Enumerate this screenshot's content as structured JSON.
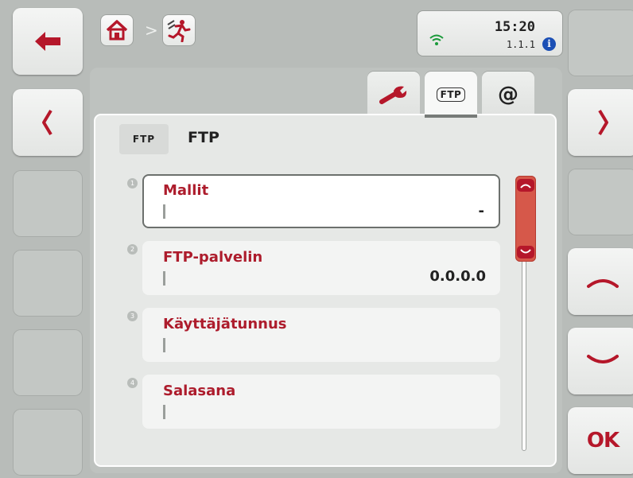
{
  "topbar": {
    "home_icon": "home-icon",
    "separator": ">",
    "app_icon": "ftp-settings-running-man-icon",
    "status": {
      "time": "15:20",
      "version": "1.1.1"
    }
  },
  "left_buttons": {
    "back": "arrow-left-icon",
    "prev": "chevron-left-icon"
  },
  "right_buttons": {
    "next": "chevron-right-icon",
    "up": "chevron-up-icon",
    "down": "chevron-down-icon",
    "ok_label": "OK"
  },
  "tabs": [
    {
      "name": "settings",
      "icon": "wrench-icon"
    },
    {
      "name": "ftp",
      "label": "FTP",
      "active": true
    },
    {
      "name": "email",
      "label": "@"
    }
  ],
  "header": {
    "icon_label": "FTP",
    "title": "FTP"
  },
  "items": [
    {
      "index": "1",
      "label": "Mallit",
      "value": "-",
      "selected": true
    },
    {
      "index": "2",
      "label": "FTP-palvelin",
      "value": "0.0.0.0",
      "selected": false
    },
    {
      "index": "3",
      "label": "Käyttäjätunnus",
      "value": "",
      "selected": false
    },
    {
      "index": "4",
      "label": "Salasana",
      "value": "",
      "selected": false
    }
  ],
  "colors": {
    "accent": "#b5172a",
    "label": "#ad1c2c",
    "scroll_thumb": "#d6584a"
  }
}
